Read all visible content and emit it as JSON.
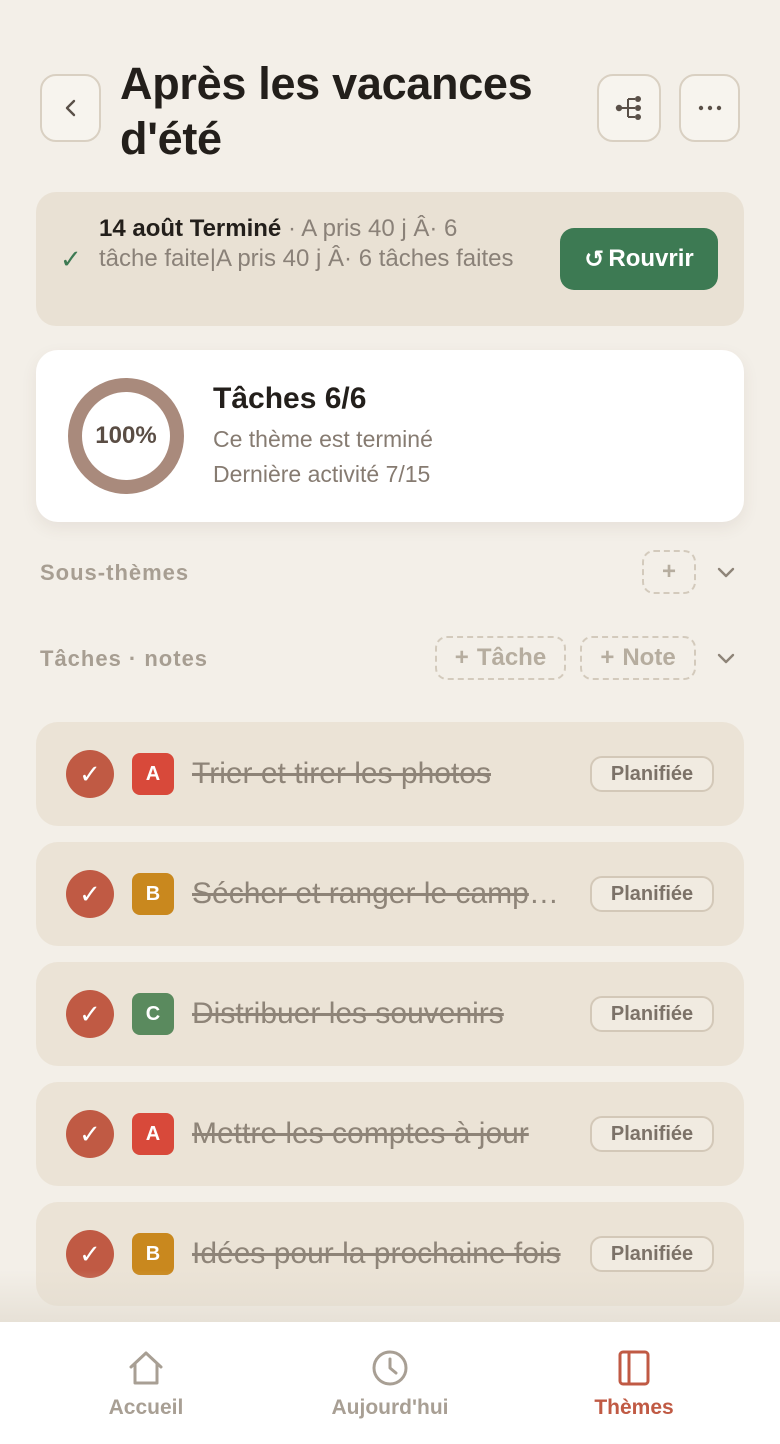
{
  "header": {
    "title": "Après les vacances d'été"
  },
  "status": {
    "date_state": "14 août Terminé",
    "detail": " · A pris 40 j Â· 6 tâche faite|A pris 40 j Â· 6 tâches faites",
    "reopen_icon": "↺",
    "reopen_label": "Rouvrir"
  },
  "progress": {
    "percent_label": "100%",
    "percent_value": 100,
    "title": "Tâches 6/6",
    "subtitle": "Ce thème est terminé",
    "last_activity": "Dernière activité 7/15"
  },
  "sections": {
    "subthemes_label": "Sous-thèmes",
    "tasks_label": "Tâches · notes",
    "add_task_label": "Tâche",
    "add_note_label": "Note",
    "plus": "+"
  },
  "tasks": [
    {
      "priority": "A",
      "priority_color": "#d8493a",
      "title": "Trier et tirer les photos",
      "status": "Planifiée"
    },
    {
      "priority": "B",
      "priority_color": "#c9881e",
      "title": "Sécher et ranger le camping",
      "status": "Planifiée"
    },
    {
      "priority": "C",
      "priority_color": "#5a8a5e",
      "title": "Distribuer les souvenirs",
      "status": "Planifiée"
    },
    {
      "priority": "A",
      "priority_color": "#d8493a",
      "title": "Mettre les comptes à jour",
      "status": "Planifiée"
    },
    {
      "priority": "B",
      "priority_color": "#c9881e",
      "title": "Idées pour la prochaine fois",
      "status": "Planifiée"
    }
  ],
  "nav": {
    "home_label": "Accueil",
    "today_label": "Aujourd'hui",
    "themes_label": "Thèmes"
  },
  "colors": {
    "accent": "#c05a44",
    "green": "#3d7a53",
    "ring": "#a98a7c"
  }
}
